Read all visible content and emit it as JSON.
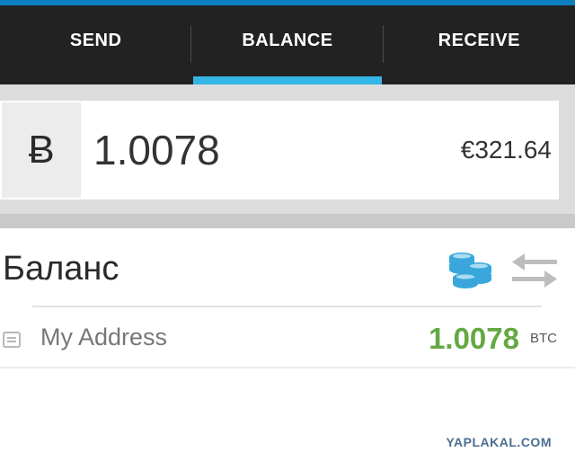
{
  "tabs": [
    {
      "label": "SEND"
    },
    {
      "label": "BALANCE"
    },
    {
      "label": "RECEIVE"
    }
  ],
  "balance": {
    "currency_symbol": "Ƀ",
    "amount": "1.0078",
    "fiat_value": "€321.64"
  },
  "section": {
    "title": "Баланс"
  },
  "address": {
    "label": "My Address",
    "amount": "1.0078",
    "unit": "BTC"
  },
  "watermark": "YAPLAKAL.COM",
  "icons": {
    "coins": "coins-stack-icon",
    "swap": "swap-arrows-icon",
    "wallet": "wallet-icon"
  },
  "colors": {
    "accent": "#33b5e5",
    "positive_amount": "#64a843",
    "tabbar": "#222222"
  }
}
